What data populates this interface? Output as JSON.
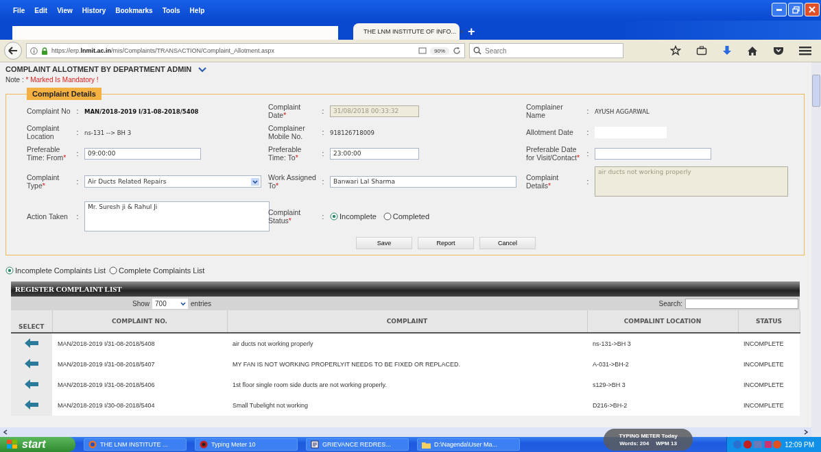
{
  "browser": {
    "menu": [
      "File",
      "Edit",
      "View",
      "History",
      "Bookmarks",
      "Tools",
      "Help"
    ],
    "tab": {
      "title": "THE LNM INSTITUTE OF INFO...",
      "close": "×"
    },
    "new_tab": "+",
    "url": "https://erp.**lnmit.ac.in**/mis/Complaints/TRANSACTION/Complaint_Allotment.aspx",
    "zoom": "90%",
    "search": {
      "placeholder": "Search"
    }
  },
  "page": {
    "title": "COMPLAINT ALLOTMENT BY DEPARTMENT ADMIN",
    "note_label": "Note :",
    "note_text": "* Marked Is Mandatory !",
    "section_title": "Complaint Details",
    "fields": [
      {
        "label": "Complaint No",
        "colon": ":",
        "kind": "bold",
        "value": "MAN/2018-2019 I/31-08-2018/5408"
      },
      {
        "label": "Complaint Date",
        "required_mark": "*",
        "colon": ":",
        "kind": "input",
        "disabled": true,
        "value": "31/08/2018 00:33:32"
      },
      {
        "label": "Complainer Name",
        "colon": ":",
        "kind": "text",
        "value": "AYUSH AGGARWAL"
      },
      {
        "label": "Complaint Location",
        "colon": ":",
        "kind": "text",
        "value": "ns-131 --> BH 3"
      },
      {
        "label": "Complainer Mobile No.",
        "colon": ":",
        "kind": "text",
        "value": "918126718009"
      },
      {
        "label": "Allotment Date",
        "colon": ":",
        "kind": "input",
        "disabled": false
      },
      {
        "label": "Preferable Time: From",
        "required_mark": "*",
        "colon": ":",
        "kind": "input",
        "disabled": false,
        "value": "09:00:00"
      },
      {
        "label": "Preferable Time: To",
        "required_mark": "*",
        "colon": ":",
        "kind": "input",
        "disabled": false,
        "value": "23:00:00"
      },
      {
        "label": "Preferable Date for Visit/Contact",
        "required_mark": "*",
        "colon": ":",
        "kind": "input",
        "disabled": false
      },
      {
        "label": "Complaint Type",
        "required_mark": "*",
        "colon": ":",
        "kind": "select",
        "value": "Air Ducts Related Repairs"
      },
      {
        "label": "Work Assigned To",
        "required_mark": "*",
        "colon": ":",
        "kind": "input",
        "disabled": false,
        "value": "Banwari Lal Sharma"
      },
      {
        "label": "Complaint Details",
        "required_mark": "*",
        "colon": ":",
        "kind": "textarea",
        "disabled": true,
        "value": "air ducts not working properly"
      },
      {
        "label": "Action Taken",
        "colon": ":",
        "kind": "textarea",
        "disabled": false,
        "value": "Mr. Suresh ji & Rahul Ji"
      },
      {
        "label": "Complaint Status",
        "required_mark": "*",
        "colon": ":",
        "kind": "radio",
        "options": [
          {
            "label": "Incomplete",
            "selected": true
          },
          {
            "label": "Completed",
            "selected": false
          }
        ]
      }
    ],
    "buttons": [
      "Save",
      "Report",
      "Cancel"
    ],
    "list_filter": [
      {
        "label": "Incomplete Complaints List",
        "selected": true
      },
      {
        "label": "Complete Complaints List",
        "selected": false
      }
    ]
  },
  "table": {
    "title": "REGISTER COMPLAINT LIST",
    "show_label": "Show",
    "entries": "700",
    "entries_label": "entries",
    "search_label": "Search:",
    "columns": [
      "SELECT",
      "COMPLAINT NO.",
      "COMPLAINT",
      "COMPALINT LOCATION",
      "STATUS"
    ],
    "rows": [
      {
        "complaint_no": "MAN/2018-2019 I/31-08-2018/5408",
        "complaint": "air ducts not working properly",
        "location": "ns-131->BH 3",
        "status": "INCOMPLETE"
      },
      {
        "complaint_no": "MAN/2018-2019 I/31-08-2018/5407",
        "complaint": "MY FAN IS NOT WORKING PROPERLYIT NEEDS TO BE FIXED OR REPLACED.",
        "location": "A-031->BH-2",
        "status": "INCOMPLETE"
      },
      {
        "complaint_no": "MAN/2018-2019 I/31-08-2018/5406",
        "complaint": "1st floor single room side ducts are not working properly.",
        "location": "s129->BH 3",
        "status": "INCOMPLETE"
      },
      {
        "complaint_no": "MAN/2018-2019 I/30-08-2018/5404",
        "complaint": "Small Tubelight not working",
        "location": "D216->BH-2",
        "status": "INCOMPLETE"
      }
    ]
  },
  "taskbar": {
    "start": "start",
    "tasks": [
      "THE LNM INSTITUTE ...",
      "Typing Meter 10",
      "GRIEVANCE REDRES...",
      "D:\\Nagenda\\User Ma..."
    ],
    "clock": "12:09 PM"
  },
  "typing_meter": {
    "title": "TYPING METER Today",
    "words": "Words: 204",
    "wpm": "WPM 13"
  }
}
